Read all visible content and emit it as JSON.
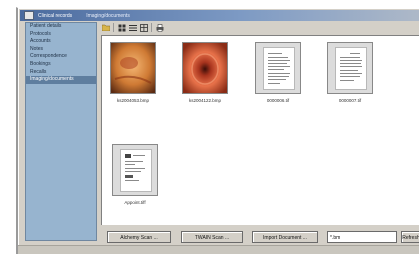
{
  "window": {
    "title": "Clinical records",
    "subtitle": "Imaging/documents"
  },
  "sidebar": {
    "items": [
      {
        "label": "Patient details"
      },
      {
        "label": "Protocols"
      },
      {
        "label": "Accounts"
      },
      {
        "label": "Notes"
      },
      {
        "label": "Correspondence"
      },
      {
        "label": "Bookings"
      },
      {
        "label": "Recalls"
      },
      {
        "label": "Imaging/documents"
      }
    ],
    "active_index": 7
  },
  "toolbar": {
    "icons": [
      "folder-open-icon",
      "thumbnail-view-icon",
      "list-view-icon",
      "details-view-icon",
      "print-icon"
    ]
  },
  "thumbnails": [
    {
      "name": "ks2004053.bmp",
      "kind": "endoscopy-image"
    },
    {
      "name": "ks2004122.bmp",
      "kind": "endoscopy-image"
    },
    {
      "name": "0000006.tif",
      "kind": "document"
    },
    {
      "name": "0000007.tif",
      "kind": "document"
    },
    {
      "name": "Appoint.tiff",
      "kind": "document"
    }
  ],
  "buttons": {
    "acquire": "Alchemy Scan ...",
    "twain": "TWAIN Scan ...",
    "import": "Import Document ...",
    "refresh": "Refresh"
  },
  "filter_field": {
    "value": "*.bm"
  },
  "colors": {
    "title_bar": "#4a6a9e",
    "sidebar_bg": "#97b4cf",
    "sidebar_active": "#5f7e9f",
    "window_bg": "#d4d0c8"
  }
}
